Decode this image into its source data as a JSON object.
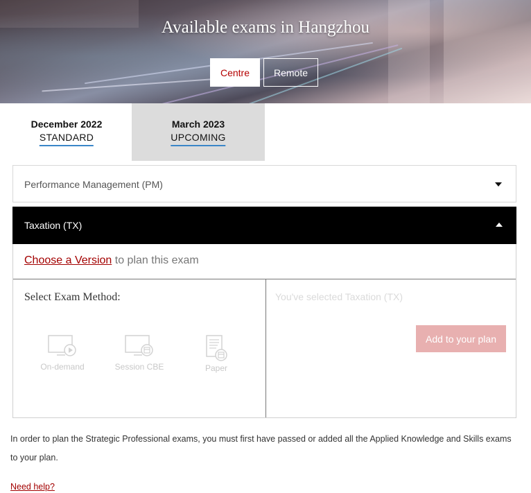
{
  "hero": {
    "title": "Available exams in Hangzhou",
    "buttons": {
      "centre": "Centre",
      "remote": "Remote"
    }
  },
  "tabs": [
    {
      "date": "December 2022",
      "status": "STANDARD",
      "active": true
    },
    {
      "date": "March 2023",
      "status": "UPCOMING",
      "active": false
    }
  ],
  "accordion": {
    "items": [
      {
        "label": "Performance Management (PM)",
        "expanded": false
      },
      {
        "label": "Taxation (TX)",
        "expanded": true
      }
    ],
    "version_prompt": {
      "link": "Choose a Version",
      "suffix": " to plan this exam"
    },
    "method_title": "Select Exam Method:",
    "methods": [
      {
        "label": "On-demand",
        "icon": "monitor-play-icon"
      },
      {
        "label": "Session CBE",
        "icon": "monitor-calendar-icon"
      },
      {
        "label": "Paper",
        "icon": "paper-calendar-icon"
      }
    ],
    "selected_text": "You've selected Taxation (TX)",
    "add_button": "Add to your plan"
  },
  "note": "In order to plan the Strategic Professional exams, you must first have passed or added all the Applied Knowledge and Skills exams to your plan.",
  "help_link": "Need help?",
  "colors": {
    "accent_red": "#b40000",
    "link_red": "#a30000",
    "tab_underline": "#3a86c8",
    "disabled_button": "#e8b0b0",
    "expanded_header": "#000000"
  }
}
